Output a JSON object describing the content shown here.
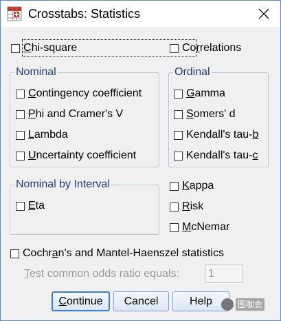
{
  "window": {
    "title": "Crosstabs: Statistics"
  },
  "top": {
    "chi_square": {
      "pre": "",
      "key": "C",
      "post": "hi-square",
      "checked": false
    },
    "correlations": {
      "pre": "Co",
      "key": "r",
      "post": "relations",
      "checked": false
    }
  },
  "nominal": {
    "legend": "Nominal",
    "items": [
      {
        "pre": "",
        "key": "C",
        "post": "ontingency coefficient",
        "checked": false
      },
      {
        "pre": "",
        "key": "P",
        "post": "hi and Cramer's V",
        "checked": false
      },
      {
        "pre": "",
        "key": "L",
        "post": "ambda",
        "checked": false
      },
      {
        "pre": "",
        "key": "U",
        "post": "ncertainty coefficient",
        "checked": false
      }
    ]
  },
  "ordinal": {
    "legend": "Ordinal",
    "items": [
      {
        "pre": "",
        "key": "G",
        "post": "amma",
        "checked": false
      },
      {
        "pre": "",
        "key": "S",
        "post": "omers' d",
        "checked": false
      },
      {
        "pre": "Kendall's tau-",
        "key": "b",
        "post": "",
        "checked": false
      },
      {
        "pre": "Kendall's tau-",
        "key": "c",
        "post": "",
        "checked": false
      }
    ]
  },
  "nominal_by_interval": {
    "legend": "Nominal by Interval",
    "items": [
      {
        "pre": "",
        "key": "E",
        "post": "ta",
        "checked": false
      }
    ]
  },
  "right_options": [
    {
      "pre": "",
      "key": "K",
      "post": "appa",
      "checked": false
    },
    {
      "pre": "",
      "key": "R",
      "post": "isk",
      "checked": false
    },
    {
      "pre": "",
      "key": "M",
      "post": "cNemar",
      "checked": false
    }
  ],
  "cochran": {
    "pre": "Cochr",
    "key": "a",
    "post": "n's and Mantel-Haenszel statistics",
    "checked": false,
    "odds_label": {
      "pre": "",
      "key": "T",
      "post": "est common odds ratio equals:"
    },
    "odds_value": "1"
  },
  "buttons": [
    {
      "pre": "",
      "key": "C",
      "post": "ontinue",
      "default": true
    },
    {
      "pre": "Cancel",
      "key": "",
      "post": "",
      "default": false
    },
    {
      "pre": "Help",
      "key": "",
      "post": "",
      "default": false
    }
  ],
  "watermark": {
    "text": "图咖会"
  }
}
